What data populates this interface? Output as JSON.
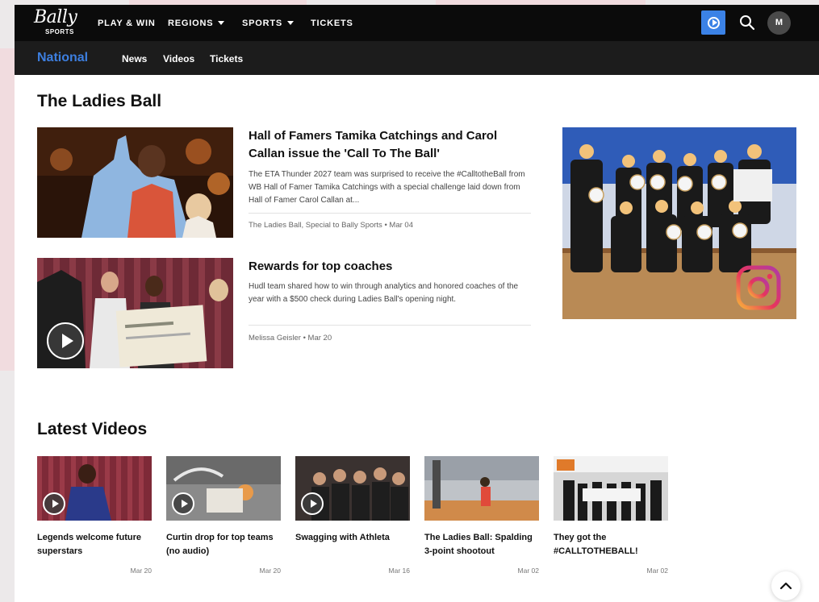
{
  "brand": {
    "logo_script": "Bally",
    "logo_sub": "SPORTS"
  },
  "topnav": {
    "items": [
      {
        "label": "PLAY & WIN",
        "dropdown": false
      },
      {
        "label": "REGIONS",
        "dropdown": true
      },
      {
        "label": "SPORTS",
        "dropdown": true
      },
      {
        "label": "TICKETS",
        "dropdown": false
      }
    ],
    "play_icon": "play-circle-icon",
    "search_icon": "search-icon",
    "avatar_initial": "M",
    "accent_color": "#3b82e6"
  },
  "subnav": {
    "title": "National",
    "items": [
      "News",
      "Videos",
      "Tickets"
    ]
  },
  "ladies_ball": {
    "heading": "The Ladies Ball",
    "articles": [
      {
        "title": "Hall of Famers Tamika Catchings and Carol Callan issue the 'Call To The Ball'",
        "description": "The ETA Thunder 2027 team was surprised to receive the #CalltotheBall from WB Hall of Famer Tamika Catchings with a special challenge laid down from Hall of Famer Carol Callan at...",
        "meta": "The Ladies Ball, Special to Bally Sports • Mar 04"
      },
      {
        "title": "Rewards for top coaches",
        "description": "Hudl team shared how to win through analytics and honored coaches of the year with a $500 check during Ladies Ball's opening night.",
        "meta": "Melissa Geisler • Mar 20"
      }
    ],
    "instagram_icon": "instagram-icon"
  },
  "latest_videos": {
    "heading": "Latest Videos",
    "items": [
      {
        "title": "Legends welcome future superstars",
        "date": "Mar 20",
        "has_play": true
      },
      {
        "title": "Curtin drop for top teams (no audio)",
        "date": "Mar 20",
        "has_play": true
      },
      {
        "title": "Swagging with Athleta",
        "date": "Mar 16",
        "has_play": true
      },
      {
        "title": "The Ladies Ball: Spalding 3-point shootout",
        "date": "Mar 02",
        "has_play": false
      },
      {
        "title": "They got the #CALLTOTHEBALL!",
        "date": "Mar 02",
        "has_play": false
      }
    ]
  },
  "scroll_top_icon": "chevron-up-icon"
}
